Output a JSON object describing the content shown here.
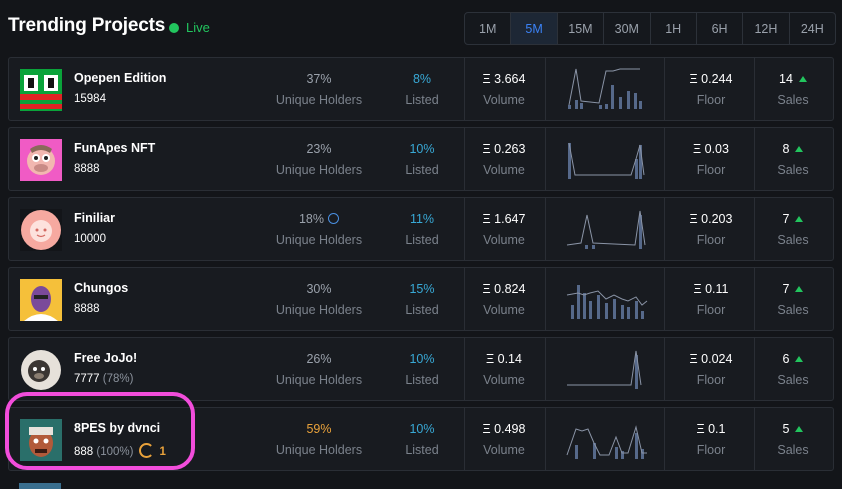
{
  "header": {
    "title": "Trending Projects",
    "live_label": "Live",
    "ranges": [
      "1M",
      "5M",
      "15M",
      "30M",
      "1H",
      "6H",
      "12H",
      "24H"
    ],
    "active_range": "5M"
  },
  "labels": {
    "holders": "Unique Holders",
    "listed": "Listed",
    "volume": "Volume",
    "floor": "Floor",
    "sales": "Sales"
  },
  "projects": [
    {
      "name": "Opepen Edition",
      "supply": "15984",
      "supply_pct": "",
      "holders": "37%",
      "listed": "8%",
      "volume": "Ξ 3.664",
      "floor": "Ξ 0.244",
      "sales": "14"
    },
    {
      "name": "FunApes NFT",
      "supply": "8888",
      "supply_pct": "",
      "holders": "23%",
      "listed": "10%",
      "volume": "Ξ 0.263",
      "floor": "Ξ 0.03",
      "sales": "8"
    },
    {
      "name": "Finiliar",
      "supply": "10000",
      "supply_pct": "",
      "holders": "18%",
      "listed": "11%",
      "volume": "Ξ 1.647",
      "floor": "Ξ 0.203",
      "sales": "7"
    },
    {
      "name": "Chungos",
      "supply": "8888",
      "supply_pct": "",
      "holders": "30%",
      "listed": "15%",
      "volume": "Ξ 0.824",
      "floor": "Ξ 0.11",
      "sales": "7"
    },
    {
      "name": "Free JoJo!",
      "supply": "7777",
      "supply_pct": "(78%)",
      "holders": "26%",
      "listed": "10%",
      "volume": "Ξ 0.14",
      "floor": "Ξ 0.024",
      "sales": "6"
    },
    {
      "name": "8PES by dvnci",
      "supply": "888",
      "supply_pct": "(100%)",
      "holders": "59%",
      "listed": "10%",
      "volume": "Ξ 0.498",
      "floor": "Ξ 0.1",
      "sales": "5",
      "pending_count": "1"
    }
  ],
  "colors": {
    "accent_blue": "#3b82f6",
    "live_green": "#22c55e",
    "listed_cyan": "#38a9d6",
    "highlight_orange": "#e9a23b",
    "annotation_pink": "#f24ddb"
  }
}
